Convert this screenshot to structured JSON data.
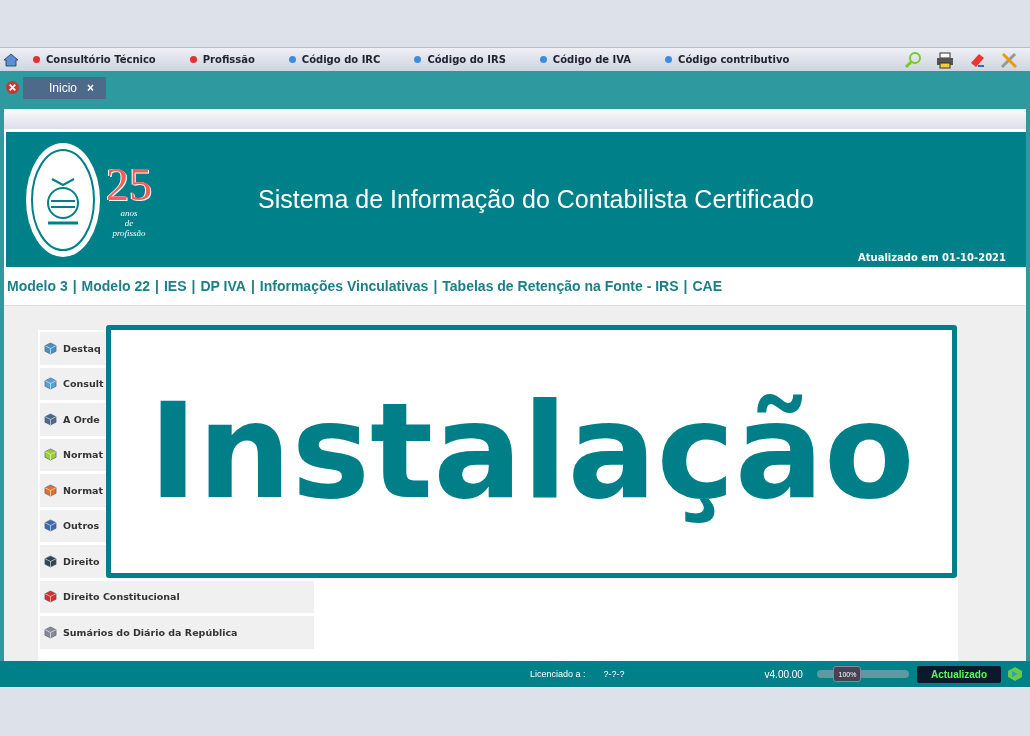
{
  "menu": [
    {
      "label": "Consultório Técnico",
      "color": "#e03030"
    },
    {
      "label": "Profissão",
      "color": "#e03030"
    },
    {
      "label": "Código do IRC",
      "color": "#3a8ee0"
    },
    {
      "label": "Código do IRS",
      "color": "#3a8ee0"
    },
    {
      "label": "Código de IVA",
      "color": "#3a8ee0"
    },
    {
      "label": "Código contributivo",
      "color": "#3a8ee0"
    }
  ],
  "tabs": [
    {
      "label": "Inicio",
      "close": "×",
      "selected": true
    }
  ],
  "banner": {
    "logo_number": "25",
    "logo_line1": "anos",
    "logo_line2": "de",
    "logo_line3": "profissão",
    "title": "Sistema de Informação do Contabilista Certificado",
    "updated": "Atualizado em 01-10-2021"
  },
  "links": [
    "Modelo 3",
    "Modelo 22",
    "IES",
    "DP IVA",
    "Informações Vinculativas",
    "Tabelas de Retenção na Fonte - IRS",
    "CAE"
  ],
  "link_separator": "|",
  "sidebar": {
    "items": [
      {
        "label": "Destaq"
      },
      {
        "label": "Consult"
      },
      {
        "label": "A Orde"
      },
      {
        "label": "Normat"
      },
      {
        "label": "Normat"
      },
      {
        "label": "Outros"
      },
      {
        "label": "Direito"
      },
      {
        "label": "Direito Constitucional"
      },
      {
        "label": "Sumários do Diário da República"
      }
    ]
  },
  "overlay": {
    "text": "Instalação"
  },
  "status_bar": {
    "license_label": "Licenciado a :",
    "license_value": "?-?-?",
    "version": "v4.00.00",
    "zoom": {
      "label": "100%",
      "level": 0.25
    },
    "state": "Actualizado"
  }
}
